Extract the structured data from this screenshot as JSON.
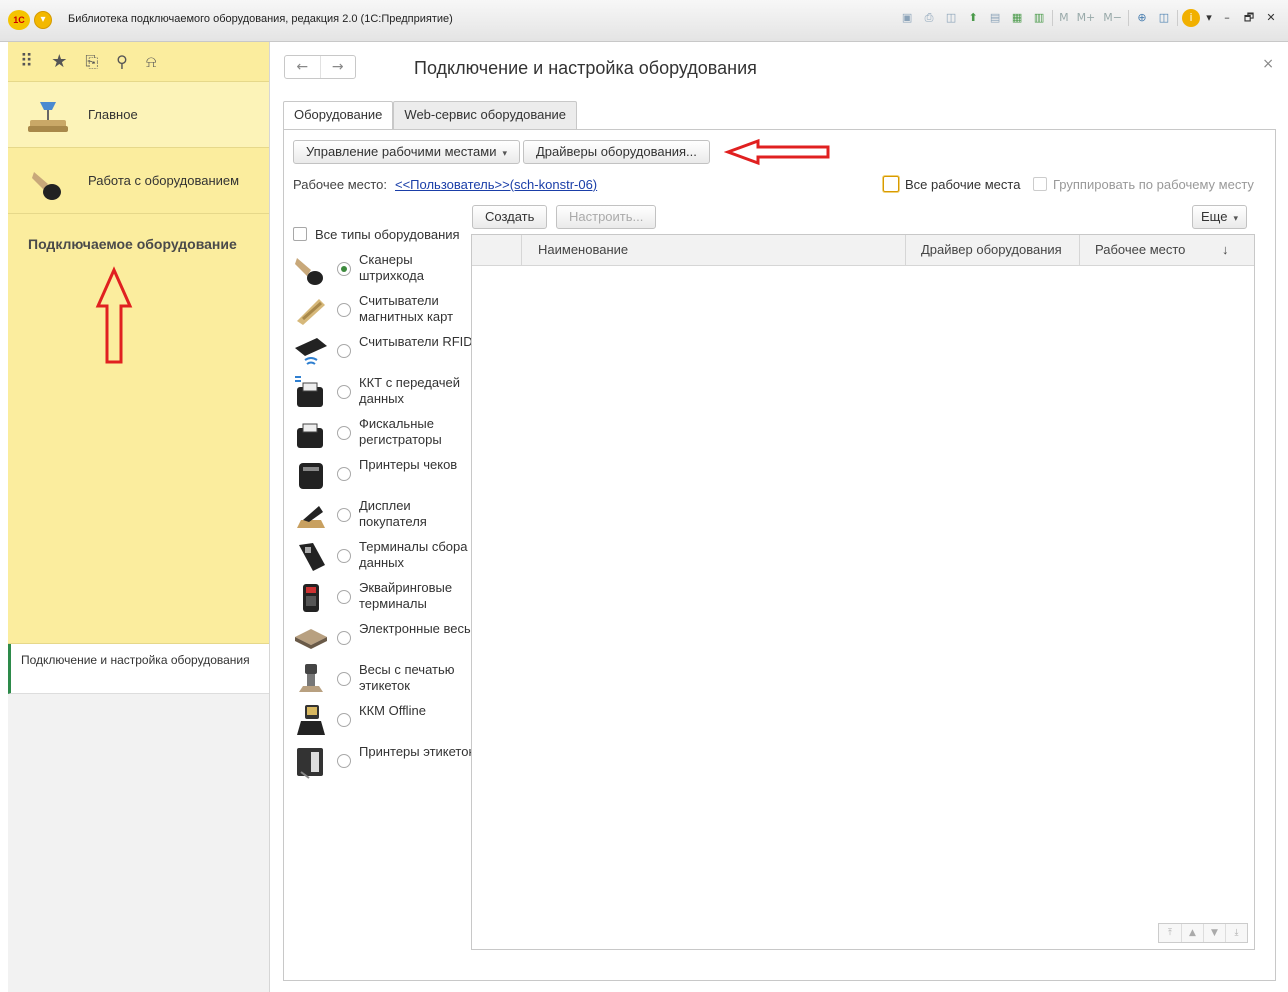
{
  "window": {
    "title": "Библиотека подключаемого оборудования, редакция 2.0  (1С:Предприятие)",
    "logo_text": "1С",
    "toolbar_tools": [
      {
        "icon": "save-icon",
        "glyph": "▣"
      },
      {
        "icon": "print-icon",
        "glyph": "⎙"
      },
      {
        "icon": "preview-icon",
        "glyph": "◫"
      },
      {
        "icon": "upload-icon",
        "glyph": "⬆"
      },
      {
        "icon": "printer-icon",
        "glyph": "▤"
      },
      {
        "icon": "calculator-icon",
        "glyph": "▦"
      },
      {
        "icon": "calendar-icon",
        "glyph": "▥"
      }
    ],
    "memory_buttons": [
      "M",
      "M+",
      "M−"
    ],
    "window_controls": [
      "–",
      "🗗",
      "✕"
    ]
  },
  "sidebar": {
    "top_icons": [
      "apps-grid-icon",
      "star-icon",
      "history-icon",
      "search-icon",
      "bell-icon"
    ],
    "sections": [
      {
        "label": "Главное",
        "icon": "desk-lamp-icon"
      },
      {
        "label": "Работа с оборудованием",
        "icon": "barcode-scanner-icon"
      }
    ],
    "panel_title": "Подключаемое оборудование",
    "open_window": "Подключение и настройка оборудования"
  },
  "main": {
    "title": "Подключение и настройка оборудования",
    "tabs": [
      {
        "label": "Оборудование",
        "active": true
      },
      {
        "label": "Web-сервис оборудование",
        "active": false
      }
    ],
    "buttons": {
      "manage_workplaces": "Управление рабочими местами",
      "drivers": "Драйверы оборудования..."
    },
    "workplace": {
      "label": "Рабочее место:",
      "value": "<<Пользователь>>(sch-konstr-06)"
    },
    "options": {
      "all_workplaces": "Все рабочие места",
      "group_by_workplace": "Группировать по рабочему месту",
      "all_types": "Все типы оборудования"
    },
    "table_toolbar": {
      "create": "Создать",
      "configure": "Настроить...",
      "more": "Еще"
    },
    "columns": [
      "Наименование",
      "Драйвер оборудования",
      "Рабочее место"
    ],
    "sort_indicator": "↓",
    "equipment_types": [
      {
        "label": "Сканеры штрихкода",
        "icon": "barcode-scanner-icon",
        "selected": true
      },
      {
        "label": "Считыватели магнитных карт",
        "icon": "magnetic-card-reader-icon",
        "selected": false
      },
      {
        "label": "Считыватели RFID",
        "icon": "rfid-reader-icon",
        "selected": false
      },
      {
        "label": "ККТ с передачей данных",
        "icon": "online-cash-register-icon",
        "selected": false
      },
      {
        "label": "Фискальные регистраторы",
        "icon": "fiscal-printer-icon",
        "selected": false
      },
      {
        "label": "Принтеры чеков",
        "icon": "receipt-printer-icon",
        "selected": false
      },
      {
        "label": "Дисплеи покупателя",
        "icon": "customer-display-icon",
        "selected": false
      },
      {
        "label": "Терминалы сбора данных",
        "icon": "data-terminal-icon",
        "selected": false
      },
      {
        "label": "Эквайринговые терминалы",
        "icon": "payment-terminal-icon",
        "selected": false
      },
      {
        "label": "Электронные весы",
        "icon": "electronic-scale-icon",
        "selected": false
      },
      {
        "label": "Весы с печатью этикеток",
        "icon": "label-scale-icon",
        "selected": false
      },
      {
        "label": "ККМ Offline",
        "icon": "offline-register-icon",
        "selected": false
      },
      {
        "label": "Принтеры этикеток",
        "icon": "label-printer-icon",
        "selected": false
      }
    ]
  },
  "colors": {
    "sidebar_bg": "#fbed9e",
    "link": "#1a3ea8",
    "annotation_arrow": "#e02020"
  }
}
